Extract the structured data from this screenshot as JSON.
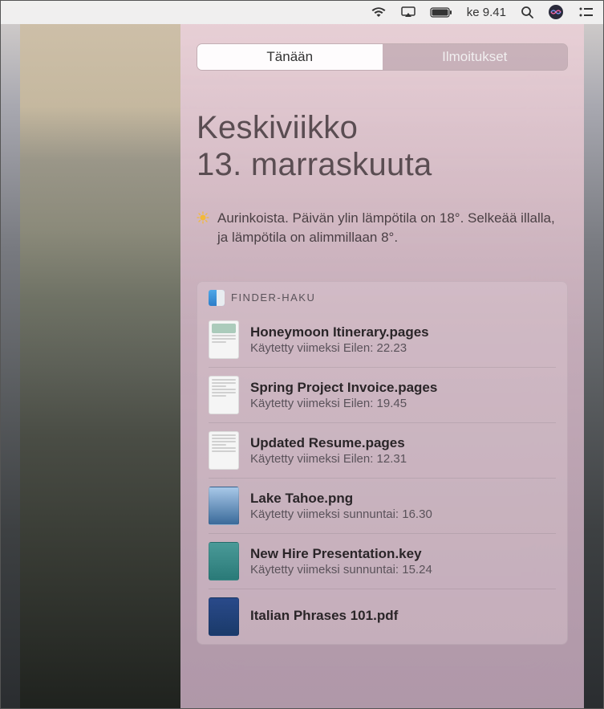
{
  "menubar": {
    "clock": "ke 9.41"
  },
  "tabs": {
    "today": "Tänään",
    "notifications": "Ilmoitukset"
  },
  "date": {
    "line1": "Keskiviikko",
    "line2": "13. marraskuuta"
  },
  "weather": {
    "text": "Aurinkoista. Päivän ylin lämpötila on 18°. Selkeää illalla, ja lämpötila on alimmillaan 8°."
  },
  "widget": {
    "title": "FINDER-HAKU",
    "items": [
      {
        "name": "Honeymoon Itinerary.pages",
        "meta": "Käytetty viimeksi Eilen: 22.23",
        "thumb": "doc-green"
      },
      {
        "name": "Spring Project Invoice.pages",
        "meta": "Käytetty viimeksi Eilen: 19.45",
        "thumb": "doc"
      },
      {
        "name": "Updated Resume.pages",
        "meta": "Käytetty viimeksi Eilen: 12.31",
        "thumb": "doc"
      },
      {
        "name": "Lake Tahoe.png",
        "meta": "Käytetty viimeksi sunnuntai: 16.30",
        "thumb": "photo"
      },
      {
        "name": "New Hire Presentation.key",
        "meta": "Käytetty viimeksi sunnuntai: 15.24",
        "thumb": "key"
      },
      {
        "name": "Italian Phrases 101.pdf",
        "meta": "",
        "thumb": "pdf"
      }
    ]
  }
}
